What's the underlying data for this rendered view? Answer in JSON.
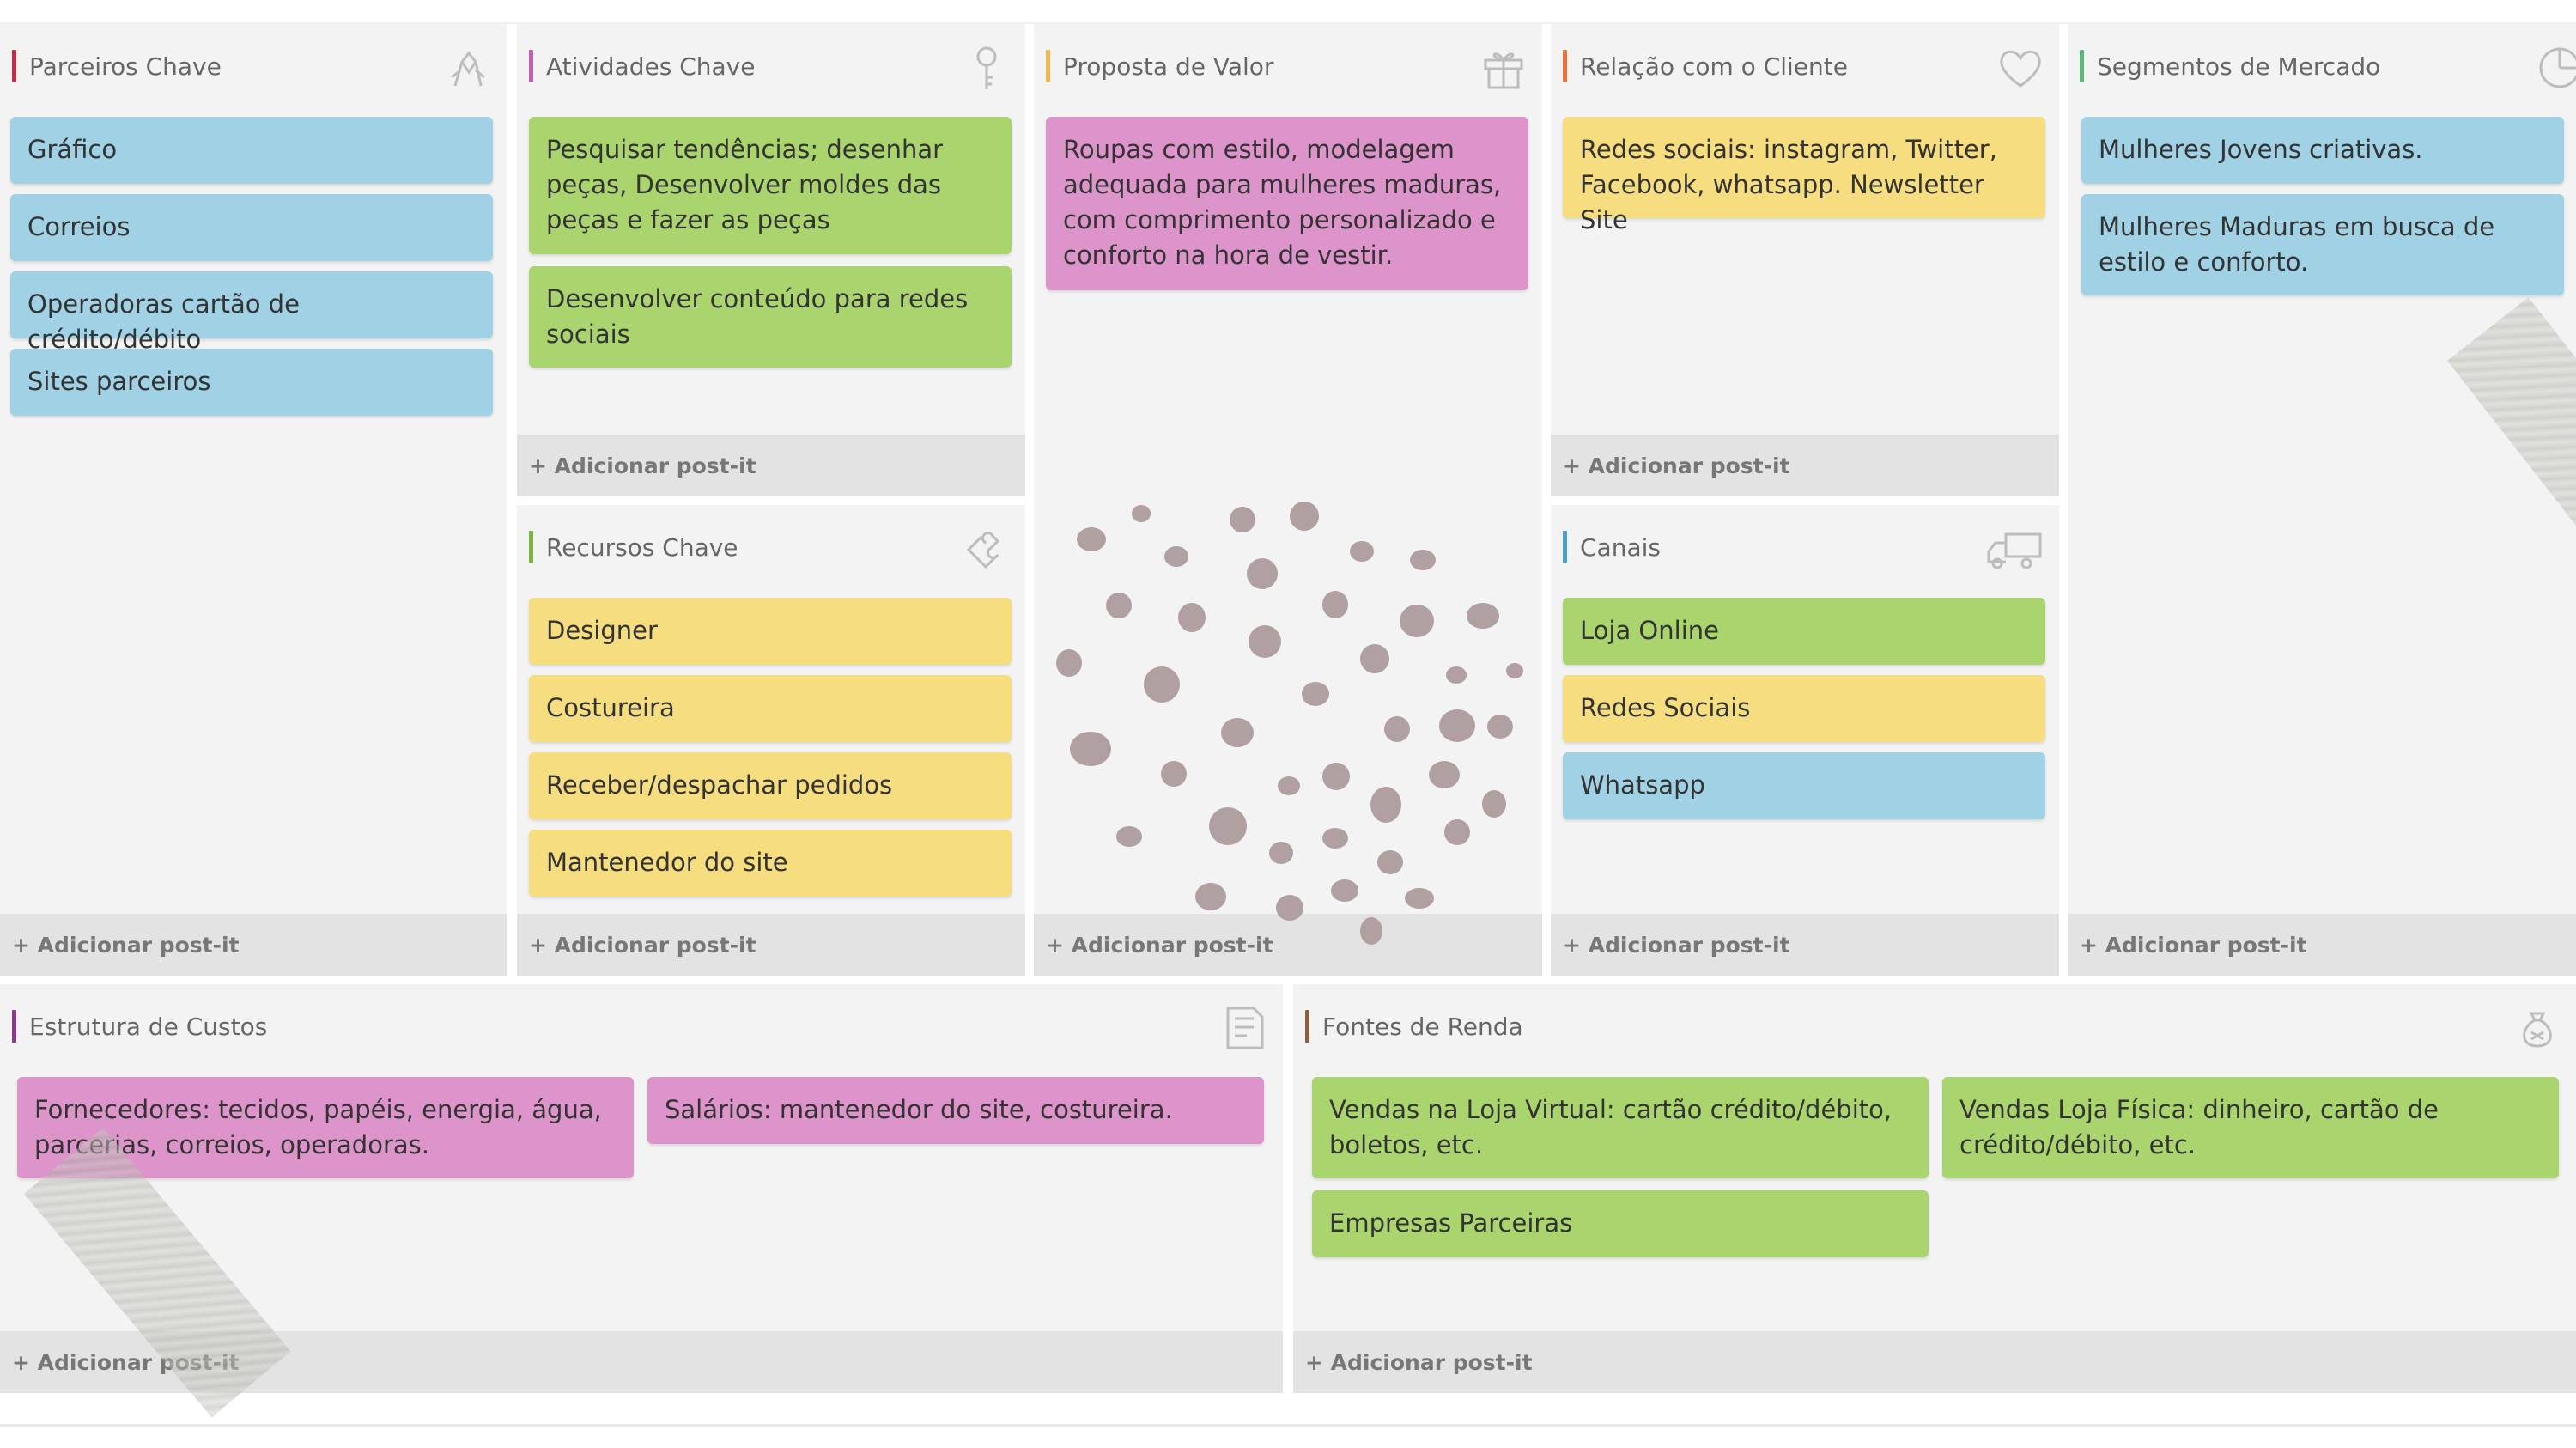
{
  "board": {
    "add_label": "+ Adicionar post-it",
    "blocks": {
      "parceiros": {
        "title": "Parceiros Chave",
        "accent": "#c0304a",
        "icon": "handshake-icon",
        "notes": [
          "Gráfico",
          "Correios",
          "Operadoras cartão de crédito/débito",
          "Sites parceiros"
        ]
      },
      "atividades": {
        "title": "Atividades Chave",
        "accent": "#c060b0",
        "icon": "key-icon",
        "notes": [
          "Pesquisar tendências; desenhar peças, Desenvolver moldes das peças e fazer as peças",
          "Desenvolver conteúdo para redes sociais"
        ]
      },
      "recursos": {
        "title": "Recursos Chave",
        "accent": "#7cb342",
        "icon": "puzzle-icon",
        "notes": [
          "Designer",
          "Costureira",
          "Receber/despachar pedidos",
          "Mantenedor do site"
        ]
      },
      "proposta": {
        "title": "Proposta de Valor",
        "accent": "#f0b84a",
        "icon": "gift-icon",
        "notes": [
          "Roupas com estilo, modelagem adequada para mulheres maduras, com comprimento personalizado e conforto na hora de vestir."
        ]
      },
      "relacao": {
        "title": "Relação com o Cliente",
        "accent": "#e8743a",
        "icon": "heart-icon",
        "notes": [
          "Redes sociais: instagram, Twitter, Facebook, whatsapp. Newsletter Site"
        ]
      },
      "canais": {
        "title": "Canais",
        "accent": "#4aa0c8",
        "icon": "truck-icon",
        "notes": [
          "Loja Online",
          "Redes Sociais",
          "Whatsapp"
        ]
      },
      "segmentos": {
        "title": "Segmentos de Mercado",
        "accent": "#5cb87a",
        "icon": "pie-chart-icon",
        "notes": [
          "Mulheres Jovens criativas.",
          "Mulheres Maduras em busca de estilo e conforto."
        ]
      },
      "custos": {
        "title": "Estrutura de Custos",
        "accent": "#8a3a8a",
        "icon": "document-icon",
        "notes": [
          "Fornecedores: tecidos, papéis, energia, água, parcerias, correios, operadoras.",
          "Salários: mantenedor do site, costureira."
        ]
      },
      "fontes": {
        "title": "Fontes de Renda",
        "accent": "#8a6040",
        "icon": "money-bag-icon",
        "notes": [
          "Vendas na Loja Virtual: cartão crédito/débito, boletos, etc.",
          "Vendas Loja Física: dinheiro, cartão de crédito/débito, etc.",
          "Empresas Parceiras"
        ]
      }
    }
  }
}
